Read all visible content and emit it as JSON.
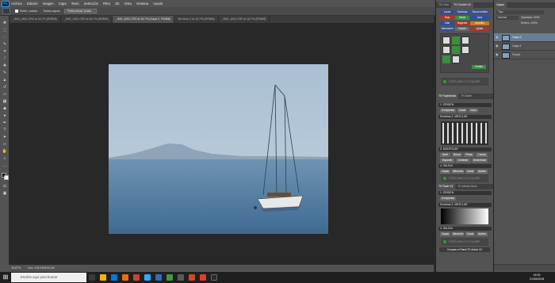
{
  "menubar": {
    "app_icon": "Ps",
    "items": [
      "Archivo",
      "Edición",
      "Imagen",
      "Capa",
      "Texto",
      "Selección",
      "Filtro",
      "3D",
      "Vista",
      "Ventana",
      "Ayuda"
    ],
    "search_placeholder": "Selector fuel"
  },
  "options": {
    "sample_label": "Todas capas",
    "auto_label": "Selec. autom.",
    "refine_button": "Perfeccionar borde..."
  },
  "tabs": [
    {
      "label": "_IMG_4911.CR2 al 16,7% (RGB/8)",
      "active": false
    },
    {
      "label": "_IMG_4911.CR2 al 16,7% (RGB/8)",
      "active": false
    },
    {
      "label": "_IMG_4911.CR2 al 16,7% (Capa 2, RGB/8)",
      "active": true
    },
    {
      "label": "Sin título-1 al 16,7% (RGB/8)",
      "active": false
    },
    {
      "label": "_IMG_4911.CR2 al 16,7% (RGB/8)",
      "active": false
    }
  ],
  "status": {
    "zoom": "16,67%",
    "doc": "Doc: 100,1M/100,1M"
  },
  "tk_panel": {
    "tabs": [
      "TK Color",
      "TK Combo V4"
    ],
    "drop_text": "Click para ir a Ayuda!",
    "section_origin": "1. ORIGEN",
    "section_sombras": "Sombras 2. MEZCLAR",
    "section_modificar": "3. MODIFICAR",
    "section_salida": "4. SALIDA",
    "buttons_top": [
      "Luces",
      "Sombras",
      "Tonos medios",
      "Saturación",
      "Invertir",
      "Quitar",
      "Rojo",
      "Verde",
      "Azul",
      "Cian",
      "Magenta",
      "Amarillo"
    ],
    "buttons_bottom": [
      "Capas",
      "Selección",
      "Canal",
      "Aplicar"
    ],
    "buttons_modificar": [
      "Nivel",
      "Borrar",
      "Pintar",
      "Curvas",
      "Expandir",
      "Contraer",
      "Desenfocar",
      "Suavizar"
    ],
    "recolor_button": "Comprar el Panel TK Action V2"
  },
  "tk_panel_2": {
    "tabs": [
      "TK Rank V4",
      "TK Infinity Mask"
    ],
    "section_origin": "1. ORIGEN",
    "section_sombras": "Sombras 2. MEZCLAR",
    "section_salida": "4. SALIDA",
    "drop_text": "Click para ir a Ayuda!",
    "buttons": [
      "Capas",
      "Selección",
      "Canal",
      "Aplicar"
    ]
  },
  "layers_panel": {
    "tabs": [
      "Capas"
    ],
    "kind_label": "Tipo",
    "blend_mode": "Normal",
    "opacity_label": "Opacidad: 100%",
    "fill_label": "Relleno: 100%",
    "layers": [
      {
        "name": "Capa 2",
        "selected": true
      },
      {
        "name": "Capa 1",
        "selected": false
      },
      {
        "name": "Fondo",
        "selected": false
      }
    ]
  },
  "taskbar": {
    "search_placeholder": "Escribe aquí para buscar",
    "time": "18:30",
    "date": "21/05/2018"
  }
}
